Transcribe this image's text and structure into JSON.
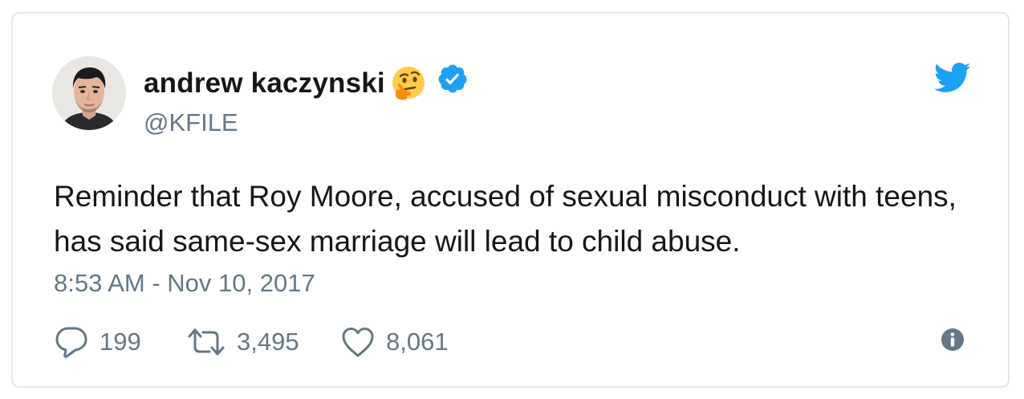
{
  "tweet": {
    "display_name": "andrew kaczynski",
    "handle": "@KFILE",
    "text": "Reminder that Roy Moore, accused of sexual misconduct with teens, has said same-sex marriage will lead to child abuse.",
    "timestamp": "8:53 AM - Nov 10, 2017"
  },
  "icons": {
    "name_emoji": "thinking-face-emoji",
    "verified": "verified-badge-icon",
    "brand": "twitter-bird-icon",
    "reply": "reply-icon",
    "retweet": "retweet-icon",
    "like": "heart-icon",
    "info": "info-icon"
  },
  "actions": {
    "replies": "199",
    "retweets": "3,495",
    "likes": "8,061"
  },
  "colors": {
    "brand_blue": "#1da1f2",
    "secondary_text": "#657786",
    "primary_text": "#14171a",
    "border": "#e1e8ed"
  }
}
